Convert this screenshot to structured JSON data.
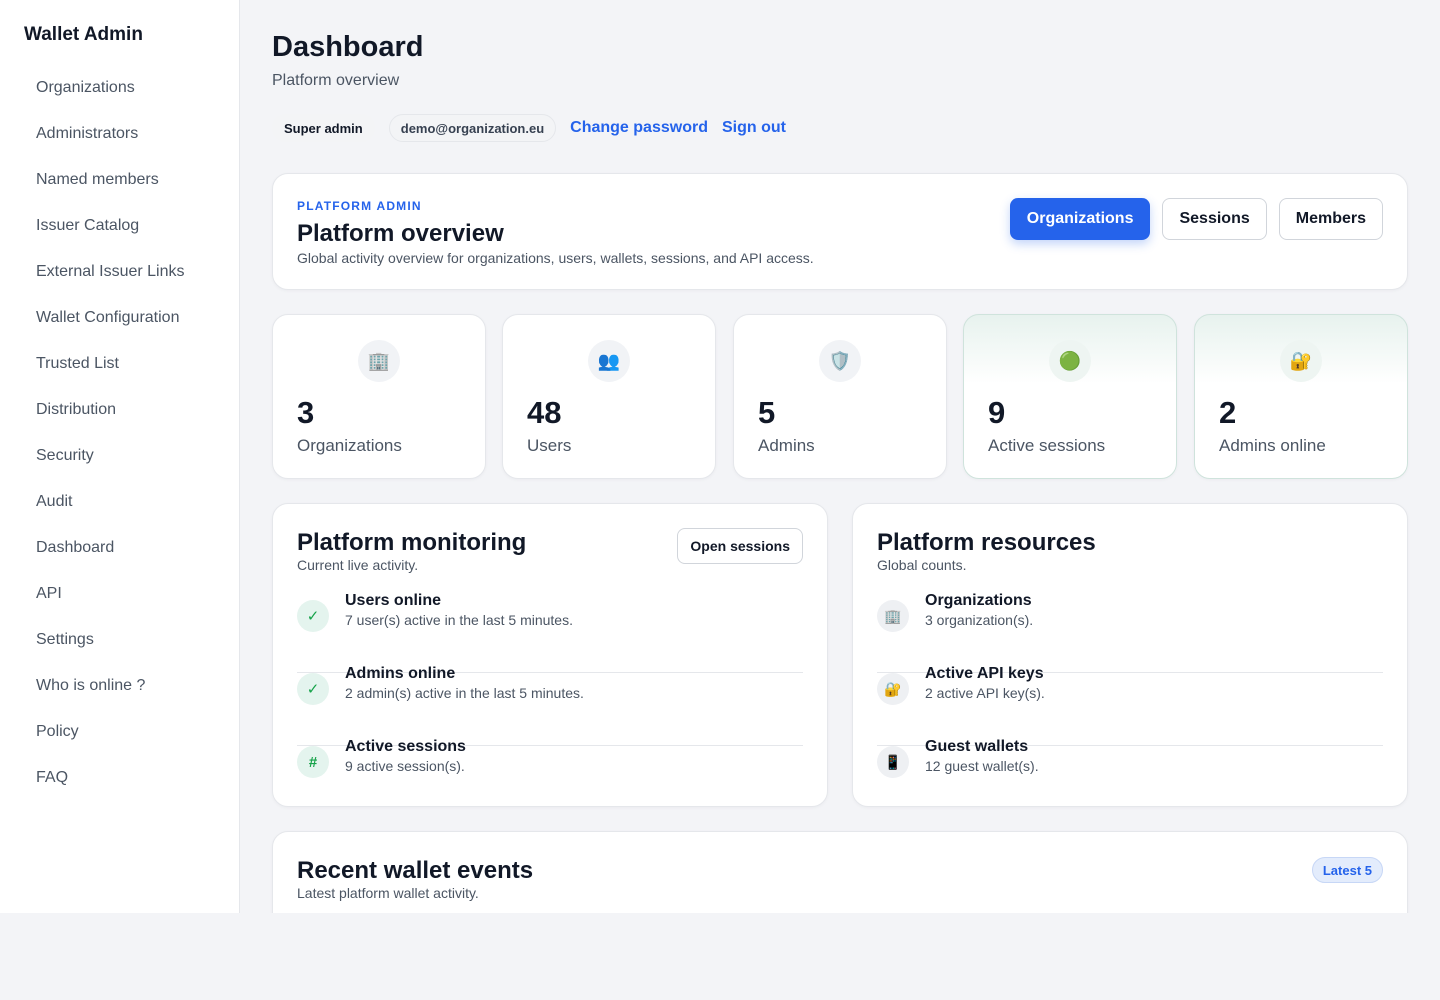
{
  "sidebar": {
    "brand": "Wallet Admin",
    "items": [
      {
        "label": "Organizations"
      },
      {
        "label": "Administrators"
      },
      {
        "label": "Named members"
      },
      {
        "label": "Issuer Catalog"
      },
      {
        "label": "External Issuer Links"
      },
      {
        "label": "Wallet Configuration"
      },
      {
        "label": "Trusted List"
      },
      {
        "label": "Distribution"
      },
      {
        "label": "Security"
      },
      {
        "label": "Audit"
      },
      {
        "label": "Dashboard"
      },
      {
        "label": "API"
      },
      {
        "label": "Settings"
      },
      {
        "label": "Who is online ?"
      },
      {
        "label": "Policy"
      },
      {
        "label": "FAQ"
      }
    ]
  },
  "header": {
    "title": "Dashboard",
    "subtitle": "Platform overview",
    "role": "Super admin",
    "email": "demo@organization.eu",
    "change_password": "Change password",
    "sign_out": "Sign out"
  },
  "overview": {
    "eyebrow": "PLATFORM ADMIN",
    "title": "Platform overview",
    "description": "Global activity overview for organizations, users, wallets, sessions, and API access.",
    "buttons": {
      "organizations": "Organizations",
      "sessions": "Sessions",
      "members": "Members"
    }
  },
  "stats": [
    {
      "icon": "building-icon",
      "glyph": "🏢",
      "value": "3",
      "label": "Organizations"
    },
    {
      "icon": "users-icon",
      "glyph": "👥",
      "value": "48",
      "label": "Users"
    },
    {
      "icon": "shield-icon",
      "glyph": "🛡️",
      "value": "5",
      "label": "Admins"
    },
    {
      "icon": "green-dot-icon",
      "glyph": "🟢",
      "value": "9",
      "label": "Active sessions"
    },
    {
      "icon": "lock-key-icon",
      "glyph": "🔐",
      "value": "2",
      "label": "Admins online"
    }
  ],
  "monitoring": {
    "title": "Platform monitoring",
    "subtitle": "Current live activity.",
    "button": "Open sessions",
    "items": [
      {
        "icon": "check-icon",
        "glyph": "✓",
        "title": "Users online",
        "desc": "7 user(s) active in the last 5 minutes."
      },
      {
        "icon": "check-icon",
        "glyph": "✓",
        "title": "Admins online",
        "desc": "2 admin(s) active in the last 5 minutes."
      },
      {
        "icon": "hash-icon",
        "glyph": "#",
        "title": "Active sessions",
        "desc": "9 active session(s)."
      }
    ]
  },
  "resources": {
    "title": "Platform resources",
    "subtitle": "Global counts.",
    "items": [
      {
        "icon": "building-icon",
        "glyph": "🏢",
        "title": "Organizations",
        "desc": "3 organization(s)."
      },
      {
        "icon": "lock-key-icon",
        "glyph": "🔐",
        "title": "Active API keys",
        "desc": "2 active API key(s)."
      },
      {
        "icon": "mobile-phone-icon",
        "glyph": "📱",
        "title": "Guest wallets",
        "desc": "12 guest wallet(s)."
      }
    ]
  },
  "events": {
    "title": "Recent wallet events",
    "subtitle": "Latest platform wallet activity.",
    "badge": "Latest 5"
  },
  "colors": {
    "accent": "#2563eb",
    "success": "#16a34a",
    "success_bg": "#e4f4ee",
    "background": "#f3f4f7"
  }
}
